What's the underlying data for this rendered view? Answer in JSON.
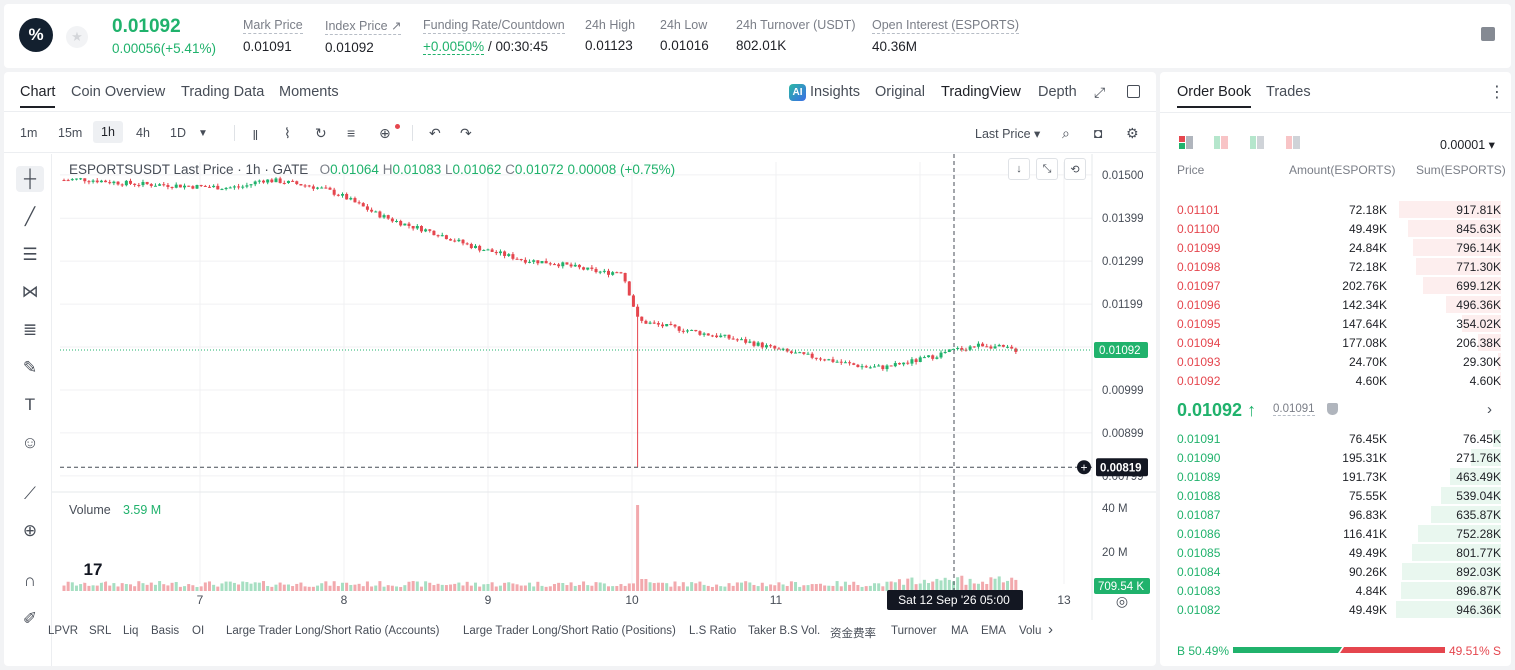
{
  "header": {
    "logo_glyph": "%",
    "star_glyph": "★",
    "last_price": "0.01092",
    "change": "0.00056(+5.41%)",
    "stats": [
      {
        "label": "Mark Price",
        "value": "0.01091"
      },
      {
        "label": "Index Price ↗",
        "value": "0.01092"
      },
      {
        "label": "Funding Rate/Countdown",
        "value_green": "+0.0050%",
        "value": " / 00:30:45"
      },
      {
        "label": "24h High",
        "value": "0.01123"
      },
      {
        "label": "24h Low",
        "value": "0.01016"
      },
      {
        "label": "24h Turnover (USDT)",
        "value": "802.01K"
      },
      {
        "label": "Open Interest (ESPORTS)",
        "value": "40.36M"
      }
    ]
  },
  "chart_tabs": {
    "chart": "Chart",
    "coin_overview": "Coin Overview",
    "trading_data": "Trading Data",
    "moments": "Moments"
  },
  "chart_views": {
    "ai": "AI",
    "insights": "Insights",
    "original": "Original",
    "tradingview": "TradingView",
    "depth": "Depth"
  },
  "intervals": [
    "1m",
    "15m",
    "1h",
    "4h",
    "1D"
  ],
  "price_type": "Last Price ▾",
  "legend": {
    "symbol": "ESPORTSUSDT Last Price · 1h · GATE",
    "o": "0.01064",
    "h": "0.01083",
    "l": "0.01062",
    "c": "0.01072",
    "chg": "0.00008",
    "chg_pct": "(+0.75%)"
  },
  "volume_legend": {
    "label": "Volume",
    "value": "3.59 M"
  },
  "price_axis": [
    "0.01500",
    "0.01399",
    "0.01299",
    "0.01199",
    "0.01099",
    "0.00999",
    "0.00899",
    "0.00799"
  ],
  "current_price_tag": "0.01092",
  "crosshair_price_tag": "0.00819",
  "volume_axis": [
    "40 M",
    "20 M"
  ],
  "volume_tag": "709.54 K",
  "time_axis": [
    "7",
    "8",
    "9",
    "10",
    "11",
    "12",
    "13"
  ],
  "crosshair_time": "Sat 12 Sep '26   05:00",
  "tv_logo": "17",
  "indicators": [
    "LPVR",
    "SRL",
    "Liq",
    "Basis",
    "OI",
    "Large Trader Long/Short Ratio (Accounts)",
    "Large Trader Long/Short Ratio (Positions)",
    "L.S Ratio",
    "Taker B.S Vol.",
    "资金费率",
    "Turnover",
    "MA",
    "EMA",
    "Volu"
  ],
  "orderbook": {
    "tabs": {
      "orderbook": "Order Book",
      "trades": "Trades"
    },
    "precision": "0.00001 ▾",
    "headers": {
      "price": "Price",
      "amount": "Amount(ESPORTS)",
      "sum": "Sum(ESPORTS)"
    },
    "asks": [
      {
        "price": "0.01101",
        "amount": "72.18K",
        "sum": "917.81K",
        "depth": 0.97
      },
      {
        "price": "0.01100",
        "amount": "49.49K",
        "sum": "845.63K",
        "depth": 0.89
      },
      {
        "price": "0.01099",
        "amount": "24.84K",
        "sum": "796.14K",
        "depth": 0.84
      },
      {
        "price": "0.01098",
        "amount": "72.18K",
        "sum": "771.30K",
        "depth": 0.81
      },
      {
        "price": "0.01097",
        "amount": "202.76K",
        "sum": "699.12K",
        "depth": 0.74
      },
      {
        "price": "0.01096",
        "amount": "142.34K",
        "sum": "496.36K",
        "depth": 0.52
      },
      {
        "price": "0.01095",
        "amount": "147.64K",
        "sum": "354.02K",
        "depth": 0.37
      },
      {
        "price": "0.01094",
        "amount": "177.08K",
        "sum": "206.38K",
        "depth": 0.22
      },
      {
        "price": "0.01093",
        "amount": "24.70K",
        "sum": "29.30K",
        "depth": 0.03
      },
      {
        "price": "0.01092",
        "amount": "4.60K",
        "sum": "4.60K",
        "depth": 0.005
      }
    ],
    "mid": {
      "price": "0.01092 ↑",
      "mark": "0.01091",
      "arrow": "›"
    },
    "bids": [
      {
        "price": "0.01091",
        "amount": "76.45K",
        "sum": "76.45K",
        "depth": 0.08
      },
      {
        "price": "0.01090",
        "amount": "195.31K",
        "sum": "271.76K",
        "depth": 0.29
      },
      {
        "price": "0.01089",
        "amount": "191.73K",
        "sum": "463.49K",
        "depth": 0.49
      },
      {
        "price": "0.01088",
        "amount": "75.55K",
        "sum": "539.04K",
        "depth": 0.57
      },
      {
        "price": "0.01087",
        "amount": "96.83K",
        "sum": "635.87K",
        "depth": 0.67
      },
      {
        "price": "0.01086",
        "amount": "116.41K",
        "sum": "752.28K",
        "depth": 0.79
      },
      {
        "price": "0.01085",
        "amount": "49.49K",
        "sum": "801.77K",
        "depth": 0.85
      },
      {
        "price": "0.01084",
        "amount": "90.26K",
        "sum": "892.03K",
        "depth": 0.94
      },
      {
        "price": "0.01083",
        "amount": "4.84K",
        "sum": "896.87K",
        "depth": 0.95
      },
      {
        "price": "0.01082",
        "amount": "49.49K",
        "sum": "946.36K",
        "depth": 1.0
      }
    ],
    "buy_ratio": "B 50.49%",
    "sell_ratio": "49.51% S",
    "buy_fraction": 0.5049
  },
  "colors": {
    "up": "#20b26c",
    "down": "#e5464e"
  },
  "chart_data": {
    "type": "candlestick",
    "symbol": "ESPORTSUSDT",
    "interval": "1h",
    "ylim": [
      0.0078,
      0.0153
    ],
    "day_ticks": [
      "7",
      "8",
      "9",
      "10",
      "11",
      "12",
      "13"
    ],
    "price_trend": [
      0.01488,
      0.0149,
      0.01487,
      0.01483,
      0.0148,
      0.01478,
      0.01477,
      0.01475,
      0.01473,
      0.01472,
      0.0147,
      0.01473,
      0.01488,
      0.01486,
      0.0148,
      0.01474,
      0.01465,
      0.0145,
      0.0143,
      0.0141,
      0.01395,
      0.01382,
      0.01372,
      0.0136,
      0.01345,
      0.01332,
      0.01322,
      0.01312,
      0.01302,
      0.01298,
      0.01294,
      0.01286,
      0.01278,
      0.01272,
      0.01276,
      0.0116,
      0.01152,
      0.01145,
      0.01138,
      0.0113,
      0.01124,
      0.01116,
      0.01108,
      0.01098,
      0.01088,
      0.0108,
      0.01074,
      0.01066,
      0.01058,
      0.01052,
      0.01052,
      0.0106,
      0.01068,
      0.01078,
      0.0109,
      0.01098,
      0.01105,
      0.01098,
      0.01092
    ],
    "wick_low": {
      "index": 35,
      "price": 0.00819
    },
    "volume_spike": {
      "index": 35,
      "value": "40 M"
    }
  }
}
